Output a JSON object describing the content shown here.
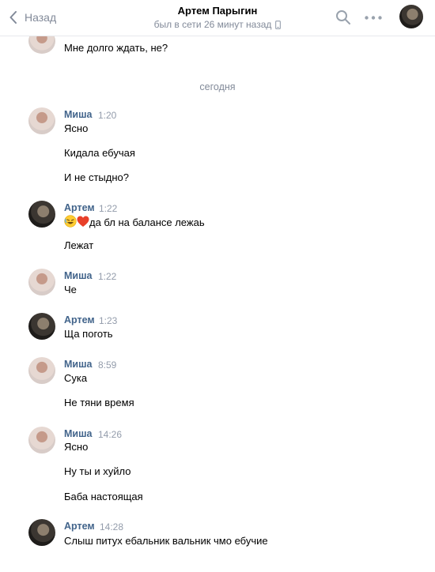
{
  "header": {
    "back_label": "Назад",
    "title": "Артем Парыгин",
    "subtitle": "был в сети 26 минут назад"
  },
  "date_separator": "сегодня",
  "top_message": "Мне долго ждать, не?",
  "messages": [
    {
      "author": "Миша",
      "time": "1:20",
      "lines": [
        "Ясно",
        "Кидала ебучая",
        "И не стыдно?"
      ]
    },
    {
      "author": "Артем",
      "time": "1:22",
      "lines": [
        "да бл на балансе лежаь",
        "Лежат"
      ]
    },
    {
      "author": "Миша",
      "time": "1:22",
      "lines": [
        "Че"
      ]
    },
    {
      "author": "Артем",
      "time": "1:23",
      "lines": [
        "Ща поготь"
      ]
    },
    {
      "author": "Миша",
      "time": "8:59",
      "lines": [
        "Сука",
        "Не тяни время"
      ]
    },
    {
      "author": "Миша",
      "time": "14:26",
      "lines": [
        "Ясно",
        "Ну ты и хуйло",
        "Баба настоящая"
      ]
    },
    {
      "author": "Артем",
      "time": "14:28",
      "lines": [
        "Слыш питух ебальник вальник чмо ебучие"
      ]
    }
  ],
  "icons": {
    "back": "chevron-left-icon",
    "search": "search-icon",
    "more": "more-dots-icon",
    "mobile": "mobile-phone-icon",
    "emoji1": "rofl-emoji",
    "emoji2": "red-heart-emoji"
  },
  "colors": {
    "link": "#42648b",
    "muted": "#828a99",
    "divider": "#e7e8ec"
  }
}
